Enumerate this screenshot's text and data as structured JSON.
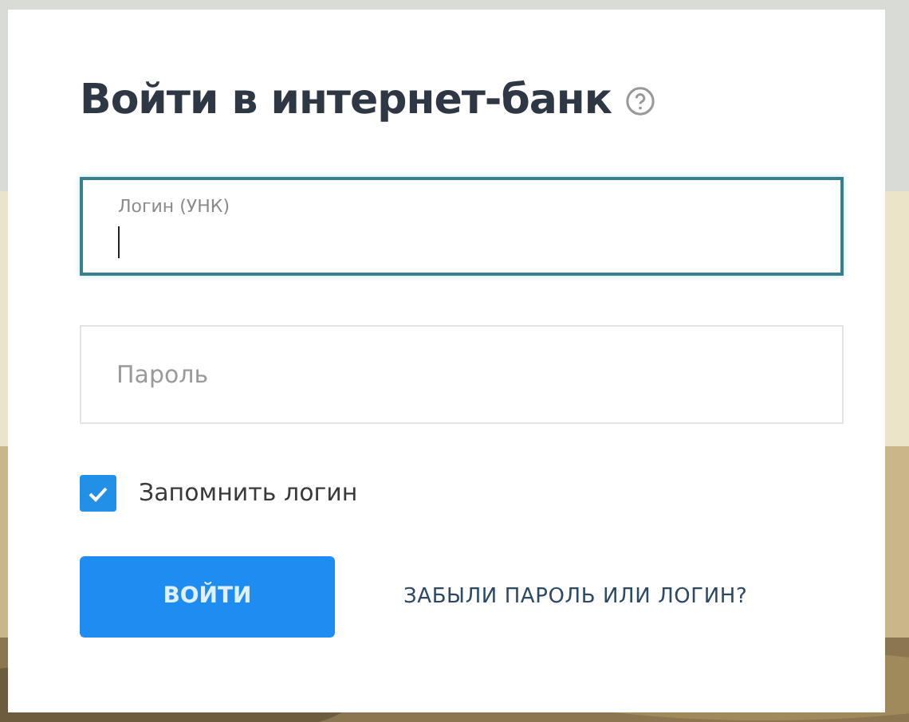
{
  "kind": "picture",
  "title": "Войти в интернет-банк",
  "fields": [
    {
      "label": "Логин (УНК)",
      "focused": true
    },
    {
      "placeholder": "Пароль",
      "focused": false
    }
  ],
  "remember": {
    "label": "Запомнить логин",
    "checked": true
  },
  "submit": "ВОЙТИ",
  "forgot_link": "ЗАБЫЛИ ПАРОЛЬ ИЛИ ЛОГИН?"
}
